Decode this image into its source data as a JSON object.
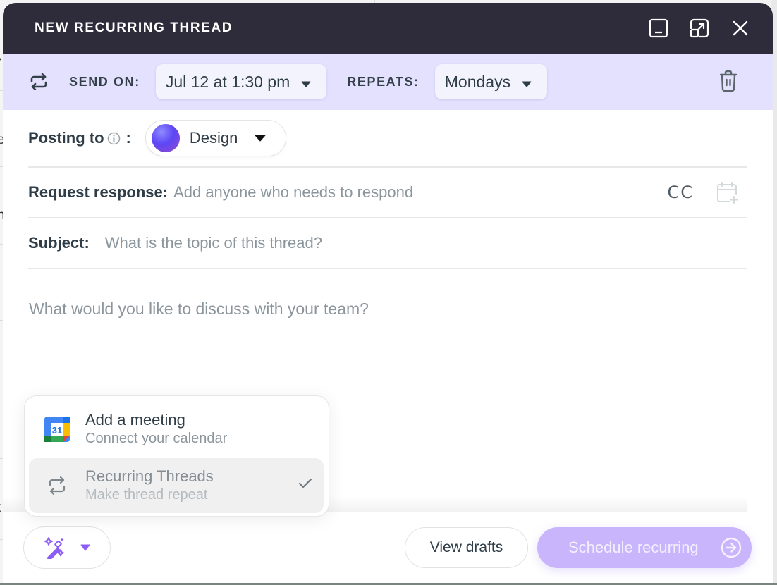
{
  "background": {
    "fragments": [
      "r",
      "e",
      "n",
      ".",
      "t"
    ]
  },
  "modal": {
    "title": "NEW RECURRING THREAD",
    "title_icons": [
      "minimize-icon",
      "expand-icon",
      "close-icon"
    ]
  },
  "schedule": {
    "send_on_label": "SEND ON:",
    "send_on_value": "Jul 12 at 1:30 pm",
    "repeats_label": "REPEATS:",
    "repeats_value": "Mondays"
  },
  "posting": {
    "label": "Posting to",
    "colon": ":",
    "group_name": "Design"
  },
  "request_response": {
    "label": "Request response:",
    "placeholder": "Add anyone who needs to respond",
    "cc_label": "CC"
  },
  "subject": {
    "label": "Subject:",
    "placeholder": "What is the topic of this thread?"
  },
  "body": {
    "placeholder": "What would you like to discuss with your team?"
  },
  "popover": {
    "items": [
      {
        "title": "Add a meeting",
        "subtitle": "Connect your calendar",
        "icon": "google-calendar-icon",
        "active": false,
        "calendar_day": "31"
      },
      {
        "title": "Recurring Threads",
        "subtitle": "Make thread repeat",
        "icon": "repeat-icon",
        "active": true
      }
    ]
  },
  "footer": {
    "view_drafts_label": "View drafts",
    "schedule_label": "Schedule recurring"
  },
  "colors": {
    "titlebar": "#2e2c3a",
    "schedule_bar": "#e3e1fd",
    "accent_purple": "#8b5cf6",
    "schedule_button": "#c9b5fb"
  }
}
